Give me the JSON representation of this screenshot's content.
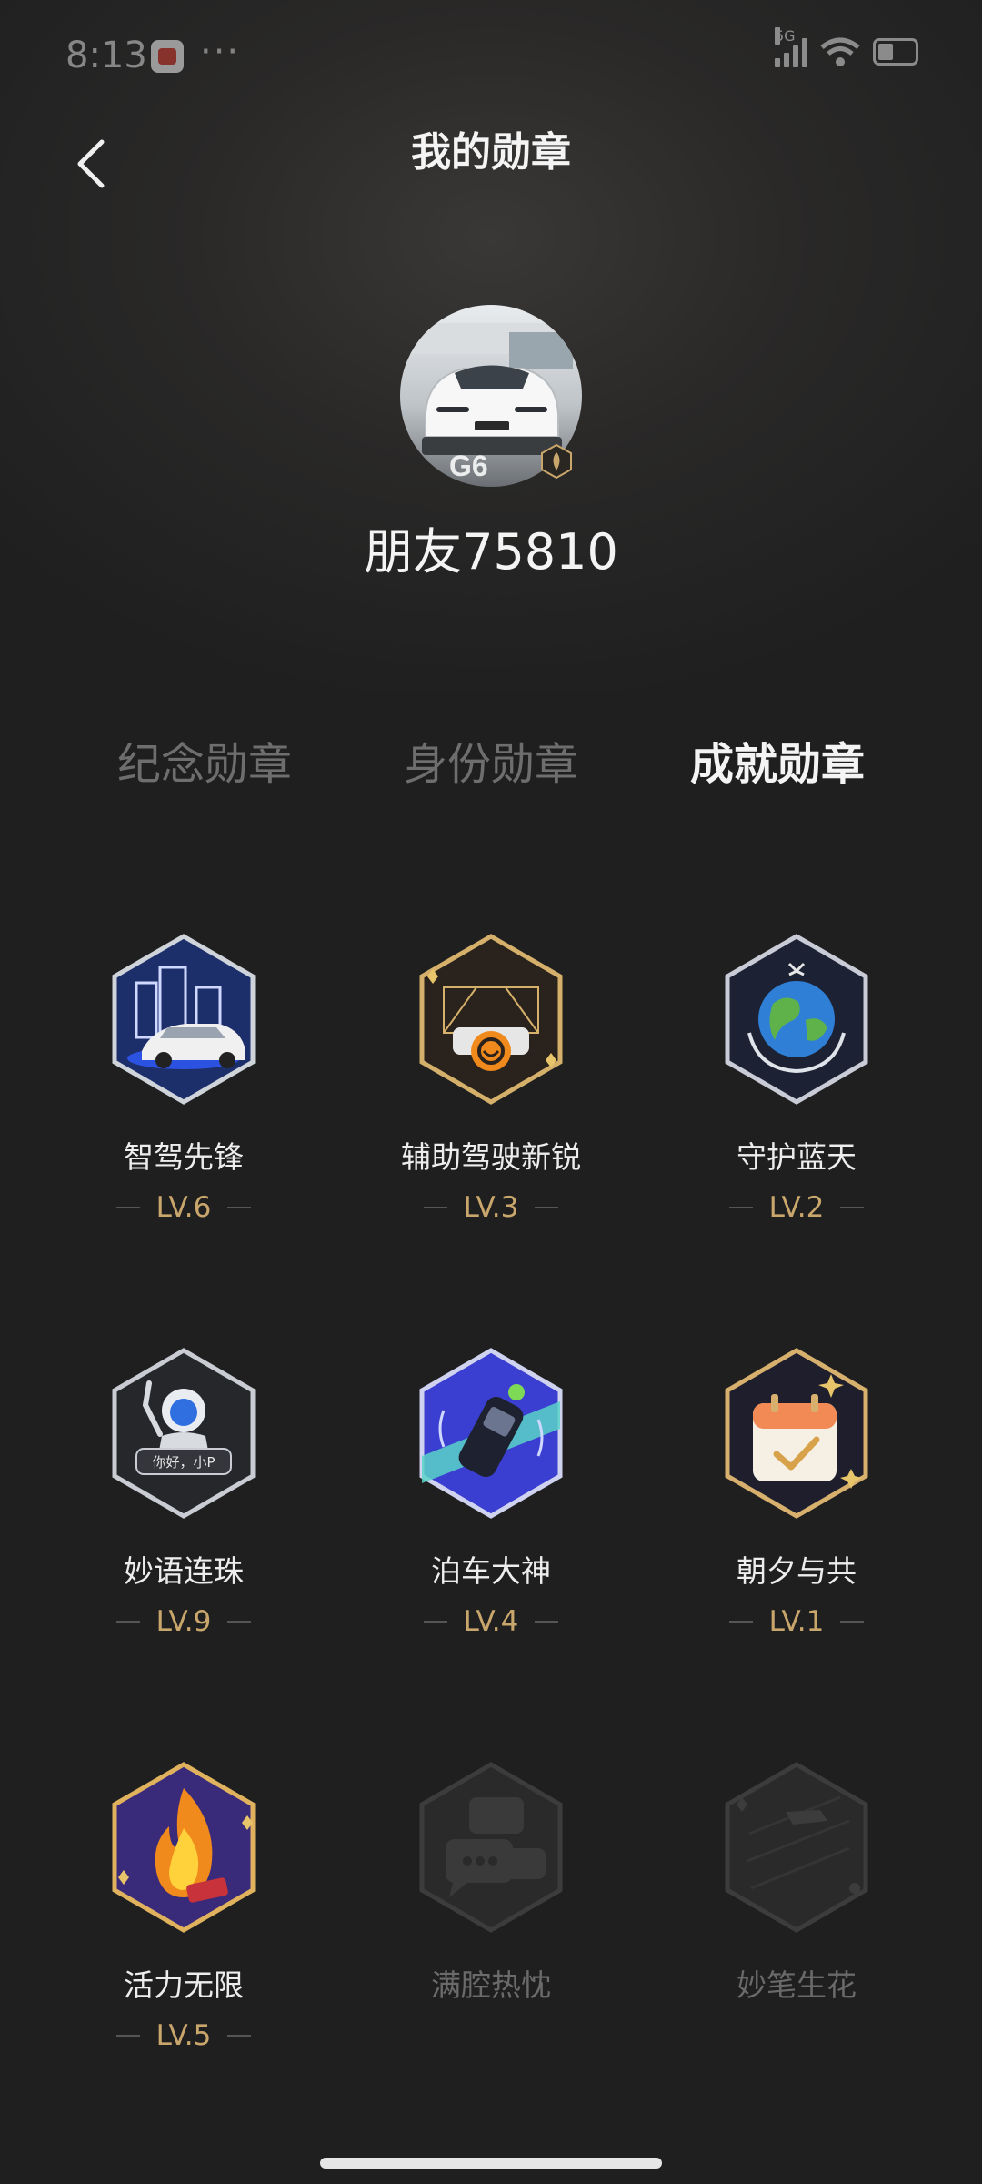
{
  "status_bar": {
    "time": "8:13",
    "more": "···",
    "network": "5G"
  },
  "header": {
    "title": "我的勋章"
  },
  "profile": {
    "username": "朋友75810",
    "car_badge": "G6"
  },
  "tabs": [
    {
      "label": "纪念勋章",
      "active": false
    },
    {
      "label": "身份勋章",
      "active": false
    },
    {
      "label": "成就勋章",
      "active": true
    }
  ],
  "medals": [
    {
      "name": "智驾先锋",
      "level": "LV.6",
      "icon": "city-car-icon",
      "unlocked": true
    },
    {
      "name": "辅助驾驶新锐",
      "level": "LV.3",
      "icon": "highway-car-icon",
      "unlocked": true
    },
    {
      "name": "守护蓝天",
      "level": "LV.2",
      "icon": "earth-hands-icon",
      "unlocked": true
    },
    {
      "name": "妙语连珠",
      "level": "LV.9",
      "icon": "robot-assistant-icon",
      "unlocked": true,
      "bubble_text": "你好，小P"
    },
    {
      "name": "泊车大神",
      "level": "LV.4",
      "icon": "parking-car-icon",
      "unlocked": true
    },
    {
      "name": "朝夕与共",
      "level": "LV.1",
      "icon": "calendar-check-icon",
      "unlocked": true
    },
    {
      "name": "活力无限",
      "level": "LV.5",
      "icon": "flame-icon",
      "unlocked": true
    },
    {
      "name": "满腔热忱",
      "level": "",
      "icon": "chat-bubbles-icon",
      "unlocked": false
    },
    {
      "name": "妙笔生花",
      "level": "",
      "icon": "pen-icon",
      "unlocked": false
    }
  ],
  "colors": {
    "accent_gold": "#c9a66b",
    "background": "#1f1f20",
    "inactive_tab": "#6e6e6e"
  }
}
